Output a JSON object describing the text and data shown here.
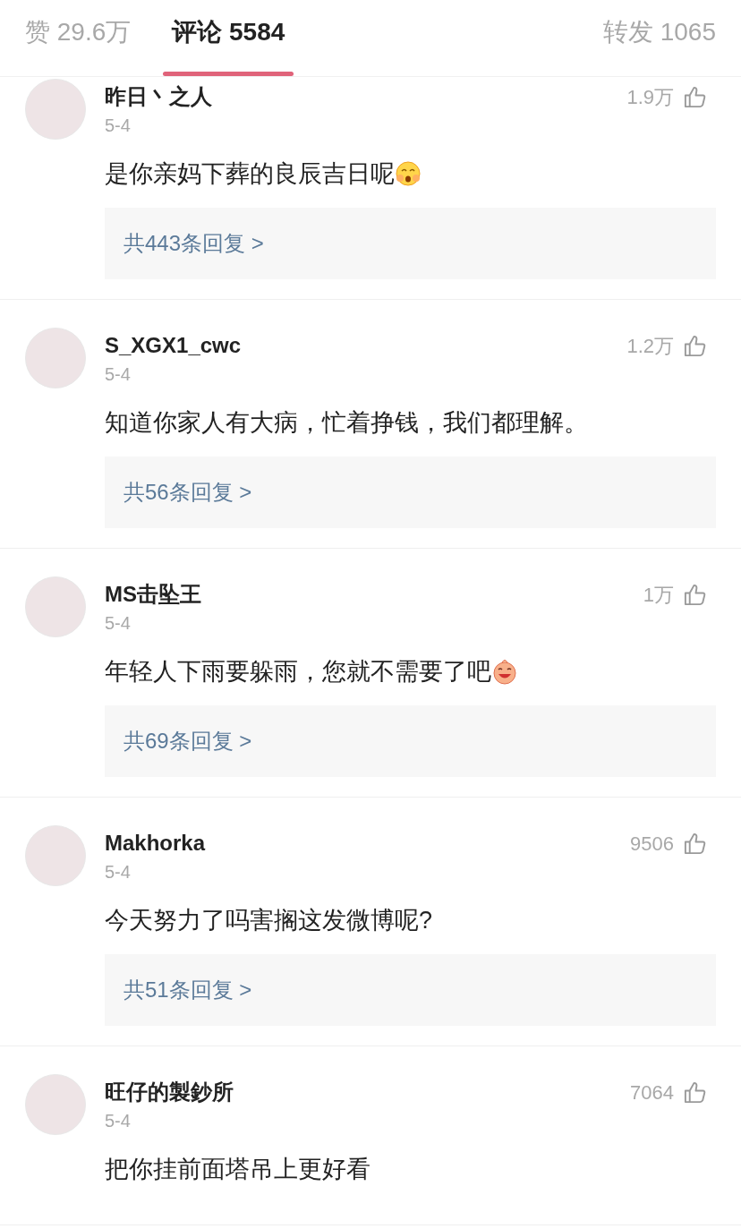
{
  "tabs": [
    {
      "label": "赞 29.6万",
      "selected": false
    },
    {
      "label": "评论 5584",
      "selected": true
    },
    {
      "label": "转发 1065",
      "selected": false
    }
  ],
  "comments": [
    {
      "user": "昨日丶之人",
      "date": "5-4",
      "likes": "1.9万",
      "text": "是你亲妈下葬的良辰吉日呢",
      "emoji": {
        "kind": "shy"
      },
      "replies": "共443条回复 >"
    },
    {
      "user": "S_XGX1_cwc",
      "date": "5-4",
      "likes": "1.2万",
      "text": "知道你家人有大病，忙着挣钱，我们都理解。",
      "replies": "共56条回复 >"
    },
    {
      "user": "MS击坠王",
      "date": "5-4",
      "likes": "1万",
      "text": "年轻人下雨要躲雨，您就不需要了吧",
      "emoji": {
        "kind": "laugh"
      },
      "replies": "共69条回复 >"
    },
    {
      "user": "Makhorka",
      "date": "5-4",
      "likes": "9506",
      "text": "今天努力了吗害搁这发微博呢?",
      "replies": "共51条回复 >"
    },
    {
      "user": "旺仔的製鈔所",
      "date": "5-4",
      "likes": "7064",
      "text": "把你挂前面塔吊上更好看"
    }
  ]
}
